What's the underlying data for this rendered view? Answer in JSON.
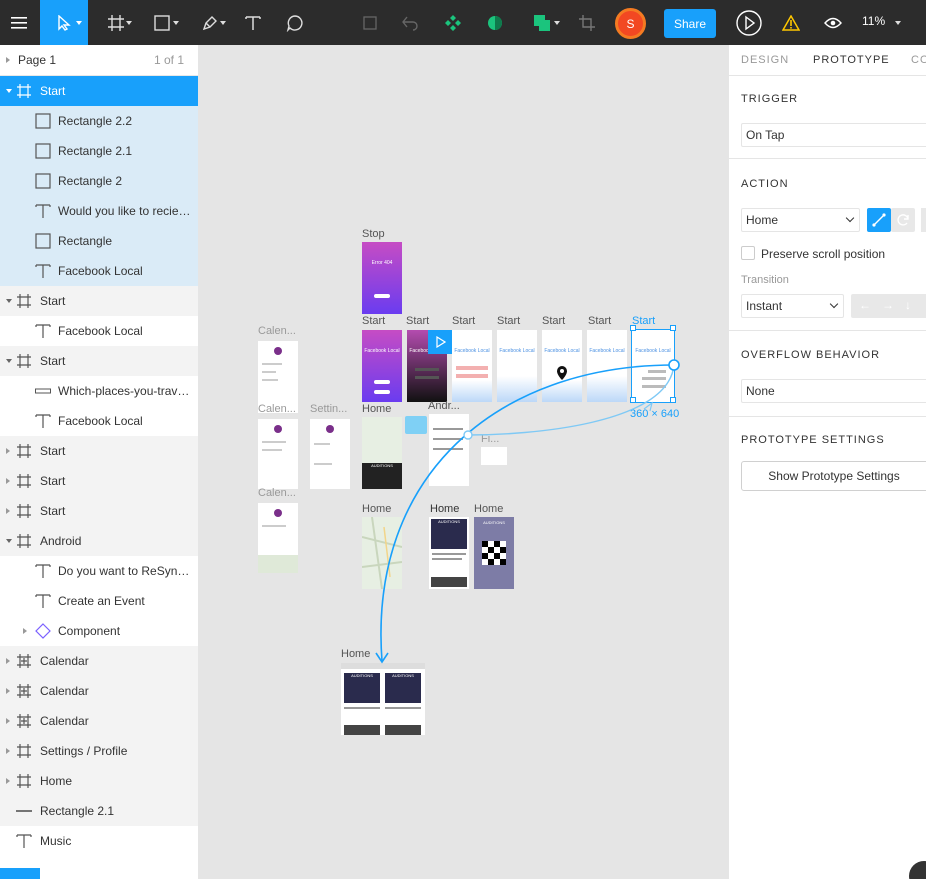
{
  "toolbar": {
    "share_label": "Share",
    "avatar_initial": "S",
    "zoom_label": "11%"
  },
  "pages": {
    "current": "Page 1",
    "count": "1 of 1"
  },
  "layers": [
    {
      "name": "Start",
      "type": "frame",
      "indent": 0,
      "state": "primary",
      "expand": "down"
    },
    {
      "name": "Rectangle 2.2",
      "type": "rect",
      "indent": 1,
      "state": "sel"
    },
    {
      "name": "Rectangle 2.1",
      "type": "rect",
      "indent": 1,
      "state": "sel"
    },
    {
      "name": "Rectangle 2",
      "type": "rect",
      "indent": 1,
      "state": "sel"
    },
    {
      "name": "Would you like to recieve n...",
      "type": "text",
      "indent": 1,
      "state": "sel"
    },
    {
      "name": "Rectangle",
      "type": "rect",
      "indent": 1,
      "state": "sel"
    },
    {
      "name": "Facebook Local",
      "type": "text",
      "indent": 1,
      "state": "sel"
    },
    {
      "name": "Start",
      "type": "frame",
      "indent": 0,
      "state": "shade",
      "expand": "down"
    },
    {
      "name": "Facebook Local",
      "type": "text",
      "indent": 1,
      "state": "none"
    },
    {
      "name": "Start",
      "type": "frame",
      "indent": 0,
      "state": "shade",
      "expand": "down"
    },
    {
      "name": "Which-places-you-travel-to",
      "type": "line-rect",
      "indent": 1,
      "state": "none"
    },
    {
      "name": "Facebook Local",
      "type": "text",
      "indent": 1,
      "state": "none"
    },
    {
      "name": "Start",
      "type": "frame",
      "indent": 0,
      "state": "shade",
      "expand": "right"
    },
    {
      "name": "Start",
      "type": "frame",
      "indent": 0,
      "state": "shade",
      "expand": "right"
    },
    {
      "name": "Start",
      "type": "frame",
      "indent": 0,
      "state": "shade",
      "expand": "right"
    },
    {
      "name": "Android",
      "type": "frame",
      "indent": 0,
      "state": "shade",
      "expand": "down"
    },
    {
      "name": "Do you want to ReSync with...",
      "type": "text",
      "indent": 1,
      "state": "none"
    },
    {
      "name": "Create an Event",
      "type": "text",
      "indent": 1,
      "state": "none"
    },
    {
      "name": "Component",
      "type": "component",
      "indent": 1,
      "state": "none",
      "expand": "right"
    },
    {
      "name": "Calendar",
      "type": "frame-plus",
      "indent": 0,
      "state": "shade",
      "expand": "right"
    },
    {
      "name": "Calendar",
      "type": "frame-plus",
      "indent": 0,
      "state": "shade",
      "expand": "right"
    },
    {
      "name": "Calendar",
      "type": "frame-plus",
      "indent": 0,
      "state": "shade",
      "expand": "right"
    },
    {
      "name": "Settings / Profile",
      "type": "frame",
      "indent": 0,
      "state": "shade",
      "expand": "right"
    },
    {
      "name": "Home",
      "type": "frame",
      "indent": 0,
      "state": "shade",
      "expand": "right"
    },
    {
      "name": "Rectangle 2.1",
      "type": "line",
      "indent": 0,
      "state": "shade"
    },
    {
      "name": "Music",
      "type": "text",
      "indent": 0,
      "state": "none"
    }
  ],
  "canvas": {
    "labels": {
      "stop": "Stop",
      "start": "Start",
      "calendar": "Calen...",
      "settings": "Settin...",
      "home": "Home",
      "android": "Andr...",
      "fi": "Fi...",
      "dimensions": "360 × 640"
    },
    "screens": {
      "error_text": "Error 404",
      "facebook_local": "Facebook Local",
      "auditions": "AUDITIONS"
    }
  },
  "inspector": {
    "tabs": [
      "DESIGN",
      "PROTOTYPE",
      "CO"
    ],
    "active_tab": "PROTOTYPE",
    "trigger_title": "TRIGGER",
    "trigger_value": "On Tap",
    "action_title": "ACTION",
    "action_value": "Home",
    "preserve_scroll_label": "Preserve scroll position",
    "transition_label": "Transition",
    "transition_value": "Instant",
    "overflow_title": "OVERFLOW BEHAVIOR",
    "overflow_value": "None",
    "prototype_settings_title": "PROTOTYPE SETTINGS",
    "prototype_settings_button": "Show Prototype Settings"
  },
  "colors": {
    "accent": "#18a0fb",
    "toolbar_bg": "#2c2c2c",
    "avatar": "#f24822",
    "selected_layer_bg": "#daebf7"
  }
}
